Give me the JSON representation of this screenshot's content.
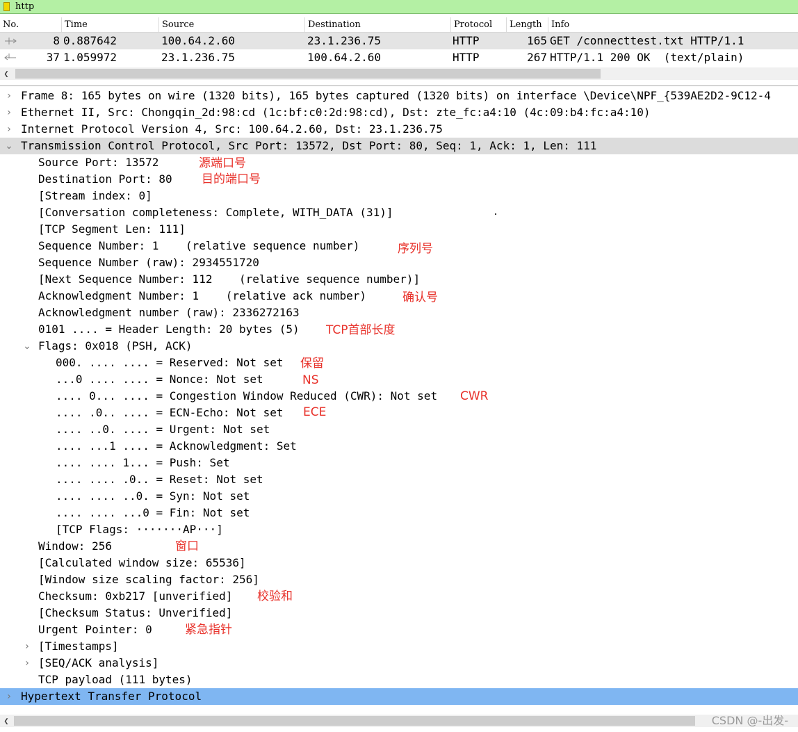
{
  "filter": {
    "value": "http",
    "accent": "#b4f0a4"
  },
  "packet_list": {
    "headers": [
      "No.",
      "Time",
      "Source",
      "Destination",
      "Protocol",
      "Length",
      "Info"
    ],
    "rows": [
      {
        "no": "8",
        "time": "0.887642",
        "src": "100.64.2.60",
        "dst": "23.1.236.75",
        "proto": "HTTP",
        "len": "165",
        "info": "GET /connecttest.txt HTTP/1.1"
      },
      {
        "no": "37",
        "time": "1.059972",
        "src": "23.1.236.75",
        "dst": "100.64.2.60",
        "proto": "HTTP",
        "len": "267",
        "info": "HTTP/1.1 200 OK  (text/plain)"
      }
    ]
  },
  "details": {
    "frame": "Frame 8: 165 bytes on wire (1320 bits), 165 bytes captured (1320 bits) on interface \\Device\\NPF_{539AE2D2-9C12-4",
    "ethernet": "Ethernet II, Src: Chongqin_2d:98:cd (1c:bf:c0:2d:98:cd), Dst: zte_fc:a4:10 (4c:09:b4:fc:a4:10)",
    "ip": "Internet Protocol Version 4, Src: 100.64.2.60, Dst: 23.1.236.75",
    "tcp": "Transmission Control Protocol, Src Port: 13572, Dst Port: 80, Seq: 1, Ack: 1, Len: 111",
    "src_port": "Source Port: 13572",
    "dst_port": "Destination Port: 80",
    "stream_index": "[Stream index: 0]",
    "conversation": "[Conversation completeness: Complete, WITH_DATA (31)]",
    "seg_len": "[TCP Segment Len: 111]",
    "seq": "Sequence Number: 1    (relative sequence number)",
    "seq_raw": "Sequence Number (raw): 2934551720",
    "next_seq": "[Next Sequence Number: 112    (relative sequence number)]",
    "ack": "Acknowledgment Number: 1    (relative ack number)",
    "ack_raw": "Acknowledgment number (raw): 2336272163",
    "hdr_len": "0101 .... = Header Length: 20 bytes (5)",
    "flags": "Flags: 0x018 (PSH, ACK)",
    "flag_reserved": "000. .... .... = Reserved: Not set",
    "flag_nonce": "...0 .... .... = Nonce: Not set",
    "flag_cwr": ".... 0... .... = Congestion Window Reduced (CWR): Not set",
    "flag_ece": ".... .0.. .... = ECN-Echo: Not set",
    "flag_urg": ".... ..0. .... = Urgent: Not set",
    "flag_ack": ".... ...1 .... = Acknowledgment: Set",
    "flag_psh": ".... .... 1... = Push: Set",
    "flag_rst": ".... .... .0.. = Reset: Not set",
    "flag_syn": ".... .... ..0. = Syn: Not set",
    "flag_fin": ".... .... ...0 = Fin: Not set",
    "tcp_flags": "[TCP Flags: ·······AP···]",
    "window": "Window: 256",
    "calc_window": "[Calculated window size: 65536]",
    "win_scale": "[Window size scaling factor: 256]",
    "checksum": "Checksum: 0xb217 [unverified]",
    "checksum_status": "[Checksum Status: Unverified]",
    "urgent_ptr": "Urgent Pointer: 0",
    "timestamps": "[Timestamps]",
    "seq_ack": "[SEQ/ACK analysis]",
    "payload": "TCP payload (111 bytes)",
    "http": "Hypertext Transfer Protocol"
  },
  "annotations": {
    "src_port": "源端口号",
    "dst_port": "目的端口号",
    "seq": "序列号",
    "ack": "确认号",
    "hdr_len": "TCP首部长度",
    "reserved": "保留",
    "nonce": "NS",
    "cwr": "CWR",
    "ece": "ECE",
    "window": "窗口",
    "checksum": "校验和",
    "urgent": "紧急指针"
  },
  "watermark": "CSDN @-出发-",
  "colors": {
    "selected_row": "#e4e4e4",
    "tcp_row": "#dcdcdc",
    "http_row": "#7fb6f2",
    "annotation": "#e8322b"
  }
}
